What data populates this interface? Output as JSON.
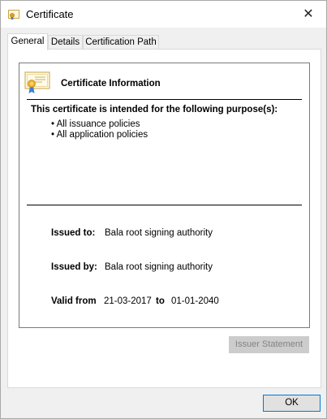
{
  "window": {
    "title": "Certificate",
    "close_symbol": "✕",
    "title_icon": "certificate-icon"
  },
  "tabs": [
    {
      "label": "General",
      "active": true
    },
    {
      "label": "Details",
      "active": false
    },
    {
      "label": "Certification Path",
      "active": false
    }
  ],
  "general": {
    "header_icon": "certificate-icon",
    "info_title": "Certificate Information",
    "purpose_title": "This certificate is intended for the following purpose(s):",
    "purposes": [
      "• All issuance policies",
      "• All application policies"
    ],
    "issued_to_label": "Issued to:",
    "issued_to": "Bala root signing authority",
    "issued_by_label": "Issued by:",
    "issued_by": "Bala root signing authority",
    "valid_from_label": "Valid from",
    "valid_from": "21-03-2017",
    "to_label": "to",
    "valid_to": "01-01-2040",
    "issuer_statement": "Issuer Statement",
    "issuer_statement_enabled": false
  },
  "footer": {
    "ok_label": "OK"
  },
  "colors": {
    "accent": "#0078d7",
    "window_bg": "#f0f0f0",
    "disabled_text": "#838383"
  }
}
